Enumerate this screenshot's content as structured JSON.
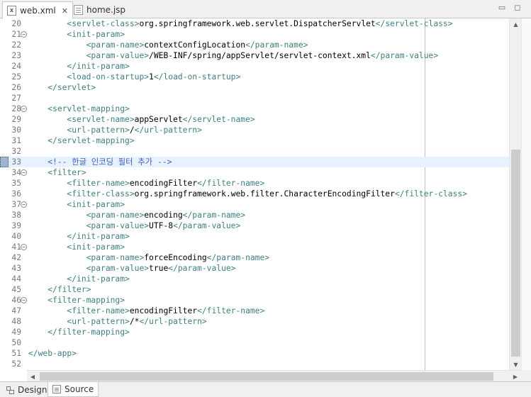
{
  "tabs": [
    {
      "label": "web.xml",
      "icon": "xml-file-icon",
      "active": true,
      "closable": true
    },
    {
      "label": "home.jsp",
      "icon": "jsp-file-icon",
      "active": false,
      "closable": false
    }
  ],
  "editor": {
    "current_line": 33,
    "lines": [
      {
        "n": "20",
        "fold": false,
        "indent": "        ",
        "parts": [
          [
            "t",
            "<servlet-class>"
          ],
          [
            "b",
            "org.springframework.web.servlet.DispatcherServlet"
          ],
          [
            "t",
            "</servlet-class>"
          ]
        ]
      },
      {
        "n": "21",
        "fold": true,
        "indent": "        ",
        "parts": [
          [
            "t",
            "<init-param>"
          ]
        ]
      },
      {
        "n": "22",
        "fold": false,
        "indent": "            ",
        "parts": [
          [
            "t",
            "<param-name>"
          ],
          [
            "b",
            "contextConfigLocation"
          ],
          [
            "t",
            "</param-name>"
          ]
        ]
      },
      {
        "n": "23",
        "fold": false,
        "indent": "            ",
        "parts": [
          [
            "t",
            "<param-value>"
          ],
          [
            "b",
            "/WEB-INF/spring/appServlet/servlet-context.xml"
          ],
          [
            "t",
            "</param-value>"
          ]
        ]
      },
      {
        "n": "24",
        "fold": false,
        "indent": "        ",
        "parts": [
          [
            "t",
            "</init-param>"
          ]
        ]
      },
      {
        "n": "25",
        "fold": false,
        "indent": "        ",
        "parts": [
          [
            "t",
            "<load-on-startup>"
          ],
          [
            "b",
            "1"
          ],
          [
            "t",
            "</load-on-startup>"
          ]
        ]
      },
      {
        "n": "26",
        "fold": false,
        "indent": "    ",
        "parts": [
          [
            "t",
            "</servlet>"
          ]
        ]
      },
      {
        "n": "27",
        "fold": false,
        "indent": "",
        "parts": []
      },
      {
        "n": "28",
        "fold": true,
        "indent": "    ",
        "parts": [
          [
            "t",
            "<servlet-mapping>"
          ]
        ]
      },
      {
        "n": "29",
        "fold": false,
        "indent": "        ",
        "parts": [
          [
            "t",
            "<servlet-name>"
          ],
          [
            "b",
            "appServlet"
          ],
          [
            "t",
            "</servlet-name>"
          ]
        ]
      },
      {
        "n": "30",
        "fold": false,
        "indent": "        ",
        "parts": [
          [
            "t",
            "<url-pattern>"
          ],
          [
            "b",
            "/"
          ],
          [
            "t",
            "</url-pattern>"
          ]
        ]
      },
      {
        "n": "31",
        "fold": false,
        "indent": "    ",
        "parts": [
          [
            "t",
            "</servlet-mapping>"
          ]
        ]
      },
      {
        "n": "32",
        "fold": false,
        "indent": "",
        "parts": []
      },
      {
        "n": "33",
        "fold": false,
        "indent": "    ",
        "parts": [
          [
            "c",
            "<!-- 한글 인코딩 필터 추가 -->"
          ]
        ]
      },
      {
        "n": "34",
        "fold": true,
        "indent": "    ",
        "parts": [
          [
            "t",
            "<filter>"
          ]
        ]
      },
      {
        "n": "35",
        "fold": false,
        "indent": "        ",
        "parts": [
          [
            "t",
            "<filter-name>"
          ],
          [
            "b",
            "encodingFilter"
          ],
          [
            "t",
            "</filter-name>"
          ]
        ]
      },
      {
        "n": "36",
        "fold": false,
        "indent": "        ",
        "parts": [
          [
            "t",
            "<filter-class>"
          ],
          [
            "b",
            "org.springframework.web.filter.CharacterEncodingFilter"
          ],
          [
            "t",
            "</filter-class>"
          ]
        ]
      },
      {
        "n": "37",
        "fold": true,
        "indent": "        ",
        "parts": [
          [
            "t",
            "<init-param>"
          ]
        ]
      },
      {
        "n": "38",
        "fold": false,
        "indent": "            ",
        "parts": [
          [
            "t",
            "<param-name>"
          ],
          [
            "b",
            "encoding"
          ],
          [
            "t",
            "</param-name>"
          ]
        ]
      },
      {
        "n": "39",
        "fold": false,
        "indent": "            ",
        "parts": [
          [
            "t",
            "<param-value>"
          ],
          [
            "b",
            "UTF-8"
          ],
          [
            "t",
            "</param-value>"
          ]
        ]
      },
      {
        "n": "40",
        "fold": false,
        "indent": "        ",
        "parts": [
          [
            "t",
            "</init-param>"
          ]
        ]
      },
      {
        "n": "41",
        "fold": true,
        "indent": "        ",
        "parts": [
          [
            "t",
            "<init-param>"
          ]
        ]
      },
      {
        "n": "42",
        "fold": false,
        "indent": "            ",
        "parts": [
          [
            "t",
            "<param-name>"
          ],
          [
            "b",
            "forceEncoding"
          ],
          [
            "t",
            "</param-name>"
          ]
        ]
      },
      {
        "n": "43",
        "fold": false,
        "indent": "            ",
        "parts": [
          [
            "t",
            "<param-value>"
          ],
          [
            "b",
            "true"
          ],
          [
            "t",
            "</param-value>"
          ]
        ]
      },
      {
        "n": "44",
        "fold": false,
        "indent": "        ",
        "parts": [
          [
            "t",
            "</init-param>"
          ]
        ]
      },
      {
        "n": "45",
        "fold": false,
        "indent": "    ",
        "parts": [
          [
            "t",
            "</filter>"
          ]
        ]
      },
      {
        "n": "46",
        "fold": true,
        "indent": "    ",
        "parts": [
          [
            "t",
            "<filter-mapping>"
          ]
        ]
      },
      {
        "n": "47",
        "fold": false,
        "indent": "        ",
        "parts": [
          [
            "t",
            "<filter-name>"
          ],
          [
            "b",
            "encodingFilter"
          ],
          [
            "t",
            "</filter-name>"
          ]
        ]
      },
      {
        "n": "48",
        "fold": false,
        "indent": "        ",
        "parts": [
          [
            "t",
            "<url-pattern>"
          ],
          [
            "b",
            "/*"
          ],
          [
            "t",
            "</url-pattern>"
          ]
        ]
      },
      {
        "n": "49",
        "fold": false,
        "indent": "    ",
        "parts": [
          [
            "t",
            "</filter-mapping>"
          ]
        ]
      },
      {
        "n": "50",
        "fold": false,
        "indent": "",
        "parts": []
      },
      {
        "n": "51",
        "fold": false,
        "indent": "",
        "parts": [
          [
            "t",
            "</web-app>"
          ]
        ]
      },
      {
        "n": "52",
        "fold": false,
        "indent": "",
        "parts": []
      }
    ]
  },
  "bottom_tabs": [
    {
      "label": "Design",
      "icon": "design-icon",
      "active": false
    },
    {
      "label": "Source",
      "icon": "source-icon",
      "active": true
    }
  ],
  "colors": {
    "tag": "#3f7f7f",
    "text": "#000000",
    "comment": "#3f5fbf",
    "current_line": "#e8f2fe"
  }
}
